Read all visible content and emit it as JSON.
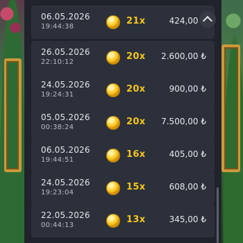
{
  "history": {
    "currency_symbol": "₺",
    "rows": [
      {
        "date": "06.05.2026",
        "time": "19:44:38",
        "multiplier": "21x",
        "amount": "424,00 ₺"
      },
      {
        "date": "26.05.2026",
        "time": "22:10:12",
        "multiplier": "20x",
        "amount": "2.600,00 ₺"
      },
      {
        "date": "24.05.2026",
        "time": "19:24:31",
        "multiplier": "20x",
        "amount": "900,00 ₺"
      },
      {
        "date": "05.05.2026",
        "time": "00:38:24",
        "multiplier": "20x",
        "amount": "7.500,00 ₺"
      },
      {
        "date": "06.05.2026",
        "time": "19:44:51",
        "multiplier": "16x",
        "amount": "405,00 ₺"
      },
      {
        "date": "24.05.2026",
        "time": "19:23:04",
        "multiplier": "15x",
        "amount": "608,00 ₺"
      },
      {
        "date": "22.05.2026",
        "time": "00:44:13",
        "multiplier": "13x",
        "amount": "345,00 ₺"
      }
    ]
  },
  "icons": {
    "coin": "gold-coin-icon",
    "scroll_up": "chevron-up-icon"
  },
  "colors": {
    "panel_bg": "#20232c",
    "row_bg": "#2c303b",
    "multiplier": "#f5c51c",
    "coin": "#f2b816"
  }
}
